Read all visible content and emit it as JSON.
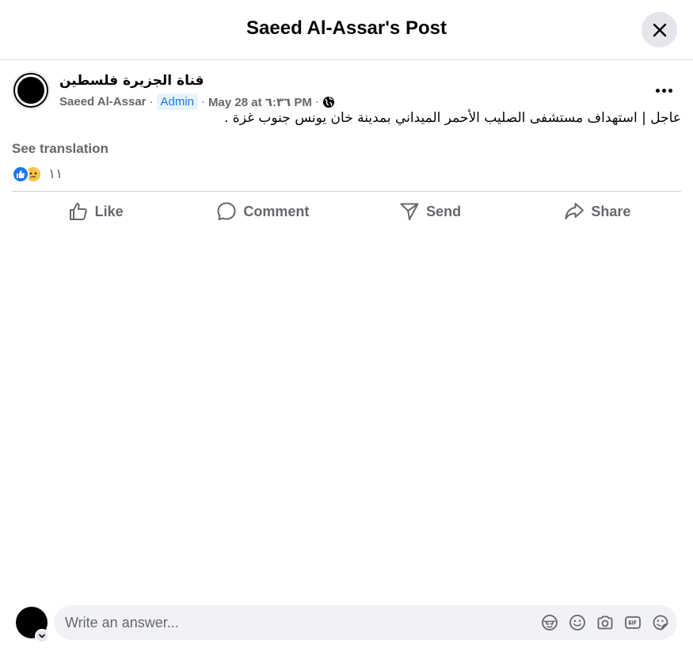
{
  "dialog": {
    "title": "Saeed Al-Assar's Post"
  },
  "post": {
    "page_name": "قناة الجزيرة فلسطين",
    "author": "Saeed Al-Assar",
    "separator": "·",
    "role_badge": "Admin",
    "timestamp": "May 28 at ٦:٣٦ PM",
    "audience_icon": "globe-icon",
    "text": "عاجل | استهداف مستشفى الصليب الأحمر الميداني بمدينة خان يونس جنوب غزة .",
    "see_translation": "See translation",
    "reaction_icons": [
      "like-icon",
      "sad-icon"
    ],
    "reaction_count": "١١"
  },
  "actions": [
    {
      "label": "Like",
      "icon": "thumbs-up-icon"
    },
    {
      "label": "Comment",
      "icon": "comment-bubble-icon"
    },
    {
      "label": "Send",
      "icon": "send-icon"
    },
    {
      "label": "Share",
      "icon": "share-arrow-icon"
    }
  ],
  "composer": {
    "placeholder": "Write an answer...",
    "icons": [
      "avatar-sticker-icon",
      "emoji-icon",
      "camera-icon",
      "gif-icon",
      "sticker-icon"
    ]
  },
  "colors": {
    "accent": "#1877f2",
    "secondary_text": "#65676b",
    "divider": "#ced0d4",
    "input_bg": "#f0f2f5"
  }
}
